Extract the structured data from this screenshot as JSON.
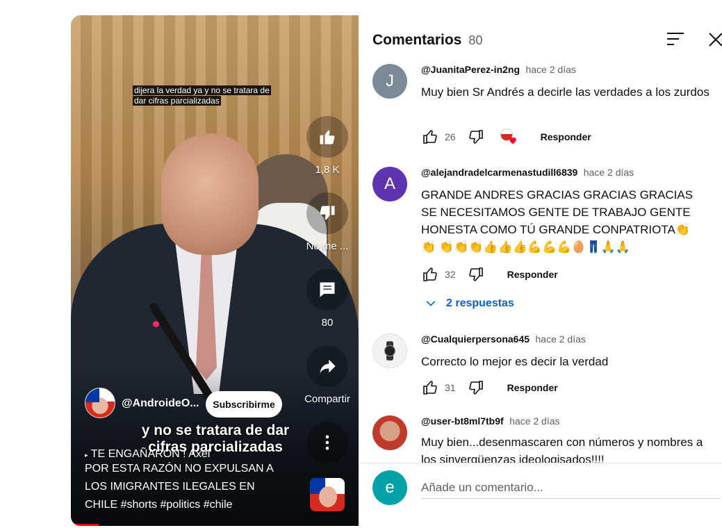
{
  "video": {
    "top_caption_line1": "dijera la verdad ya y no se tratara de",
    "top_caption_line2": "dar cifras parcializadas",
    "actions": {
      "like_count": "1,8 K",
      "dislike_label": "No me ...",
      "comments_count": "80",
      "share_label": "Compartir"
    },
    "channel": {
      "name": "@AndroideO...",
      "subscribe_label": "Subscribirme"
    },
    "burned_caption": "y no se tratara de dar cifras parcializadas",
    "title_line1": "TE ENGAÑARON ! Axel",
    "title_rest": "POR ESTA RAZÓN NO EXPULSAN A LOS IMIGRANTES ILEGALES EN CHILE #shorts #politics #chile"
  },
  "comments_panel": {
    "title": "Comentarios",
    "count": "80",
    "comments": [
      {
        "avatar_letter": "J",
        "avatar_color": "#7a8a96",
        "author": "@JuanitaPerez-in2ng",
        "time": "hace 2 días",
        "text": "Muy bien Sr Andrés a decirle las verdades a los zurdos",
        "likes": "26",
        "reply_label": "Responder"
      },
      {
        "avatar_letter": "A",
        "avatar_color": "#5e35b1",
        "author": "@alejandradelcarmenastudill6839",
        "time": "hace 2 días",
        "text": "GRANDE ANDRES GRACIAS GRACIAS GRACIAS SE NECESITAMOS GENTE DE TRABAJO GENTE HONESTA COMO TÚ GRANDE CONPATRIOTA👏 👏 👏👏👏👍👍👍💪💪💪🥚👖🙏🙏",
        "likes": "32",
        "reply_label": "Responder",
        "replies_label": "2 respuestas"
      },
      {
        "avatar_letter": "",
        "avatar_color": "#f2f2f2",
        "author": "@Cualquierpersona645",
        "time": "hace 2 días",
        "text": "Correcto lo mejor es decir la verdad",
        "likes": "31",
        "reply_label": "Responder"
      },
      {
        "avatar_letter": "",
        "avatar_color": "#c0392b",
        "author": "@user-bt8ml7tb9f",
        "time": "hace 2 días",
        "text": "Muy bien...desenmascaren con números y nombres a los sinvergüenzas ideologisados!!!!"
      }
    ],
    "footer": {
      "avatar_letter": "e",
      "placeholder": "Añade un comentario..."
    }
  }
}
